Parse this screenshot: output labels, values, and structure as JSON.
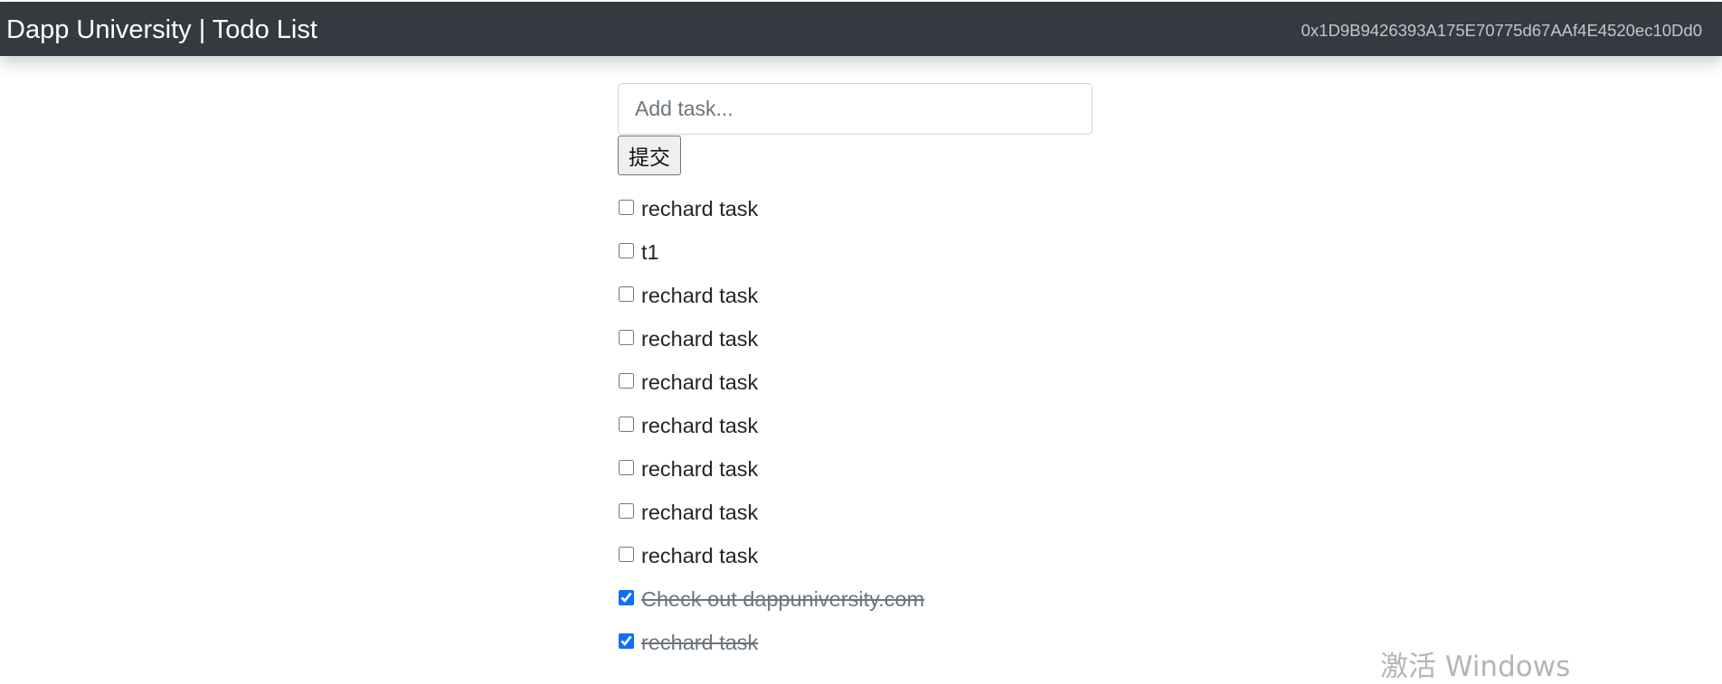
{
  "navbar": {
    "brand": "Dapp University | Todo List",
    "account": "0x1D9B9426393A175E70775d67AAf4E4520ec10Dd0"
  },
  "form": {
    "placeholder": "Add task...",
    "value": "",
    "submit_label": "提交"
  },
  "tasks": [
    {
      "content": "rechard task",
      "completed": false
    },
    {
      "content": "t1",
      "completed": false
    },
    {
      "content": "rechard task",
      "completed": false
    },
    {
      "content": "rechard task",
      "completed": false
    },
    {
      "content": "rechard task",
      "completed": false
    },
    {
      "content": "rechard task",
      "completed": false
    },
    {
      "content": "rechard task",
      "completed": false
    },
    {
      "content": "rechard task",
      "completed": false
    },
    {
      "content": "rechard task",
      "completed": false
    },
    {
      "content": "Check out dappuniversity.com",
      "completed": true
    },
    {
      "content": "rechard task",
      "completed": true
    }
  ],
  "watermark": "激活 Windows"
}
